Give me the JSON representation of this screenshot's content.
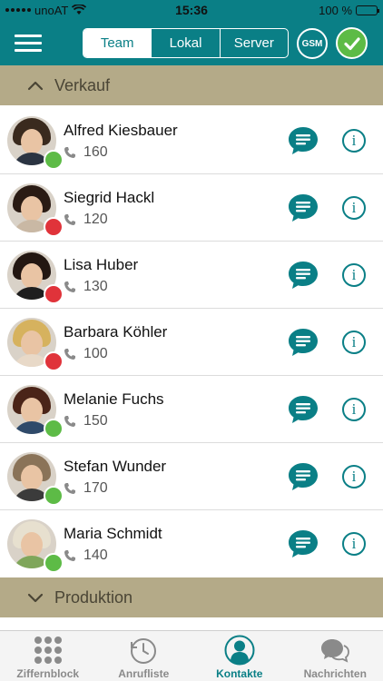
{
  "status_bar": {
    "carrier": "unoAT",
    "time": "15:36",
    "battery": "100 %"
  },
  "toolbar": {
    "segments": [
      {
        "label": "Team",
        "active": true
      },
      {
        "label": "Lokal",
        "active": false
      },
      {
        "label": "Server",
        "active": false
      }
    ],
    "gsm_label": "GSM"
  },
  "sections": {
    "verkauf": {
      "title": "Verkauf",
      "expanded": true
    },
    "produktion": {
      "title": "Produktion",
      "expanded": false
    }
  },
  "contacts": [
    {
      "name": "Alfred Kiesbauer",
      "ext": "160",
      "status": "online"
    },
    {
      "name": "Siegrid Hackl",
      "ext": "120",
      "status": "busy"
    },
    {
      "name": "Lisa Huber",
      "ext": "130",
      "status": "busy"
    },
    {
      "name": "Barbara Köhler",
      "ext": "100",
      "status": "busy"
    },
    {
      "name": "Melanie Fuchs",
      "ext": "150",
      "status": "online"
    },
    {
      "name": "Stefan Wunder",
      "ext": "170",
      "status": "online"
    },
    {
      "name": "Maria Schmidt",
      "ext": "140",
      "status": "online"
    }
  ],
  "tab_bar": [
    {
      "label": "Ziffernblock",
      "icon": "keypad-icon",
      "active": false
    },
    {
      "label": "Anrufliste",
      "icon": "history-icon",
      "active": false
    },
    {
      "label": "Kontakte",
      "icon": "contacts-icon",
      "active": true
    },
    {
      "label": "Nachrichten",
      "icon": "chat-icon",
      "active": false
    }
  ],
  "colors": {
    "primary": "#0a7f86",
    "section": "#b4aa88",
    "online": "#5dbb46",
    "busy": "#e0333a"
  }
}
